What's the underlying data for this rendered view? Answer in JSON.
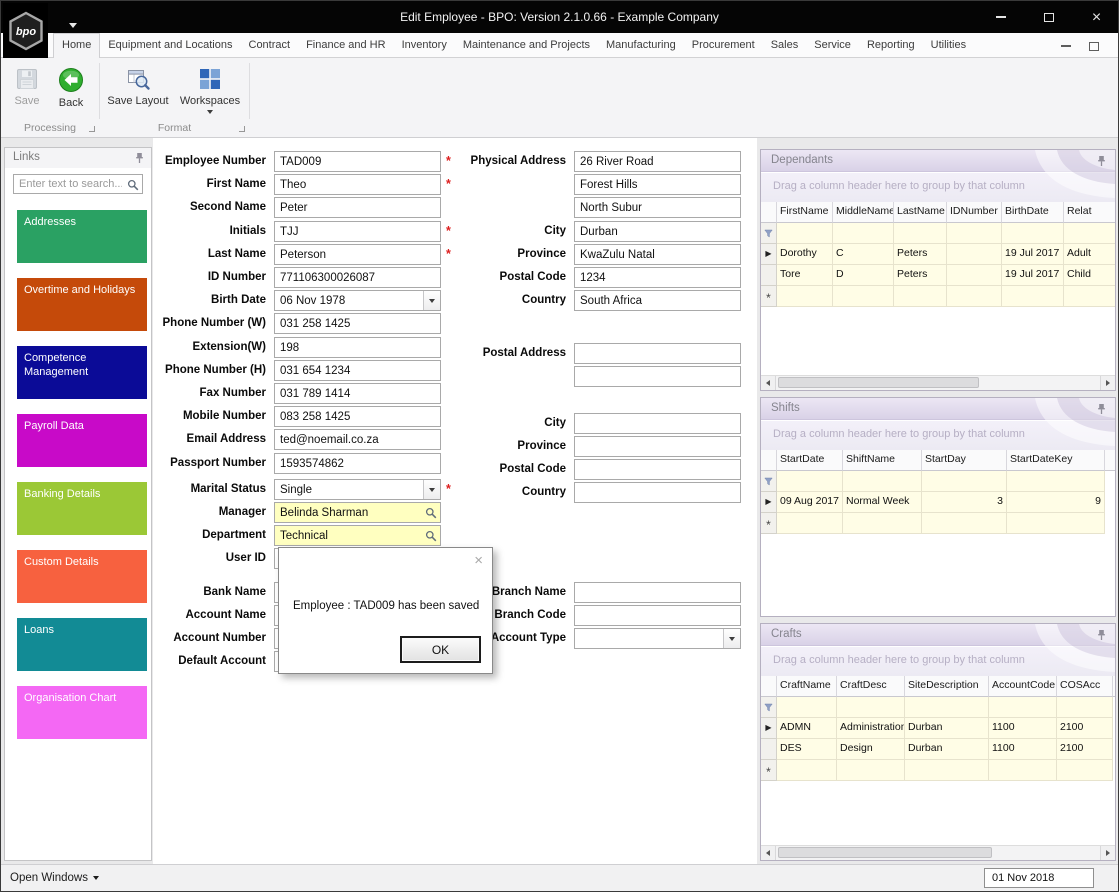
{
  "window": {
    "title": "Edit Employee - BPO: Version 2.1.0.66 - Example Company",
    "logo_text": "bpo"
  },
  "icons": {
    "close": "×",
    "row_arrow": "▶",
    "new_row": "*"
  },
  "ribbon": {
    "active_tab": 0,
    "tabs": [
      "Home",
      "Equipment and Locations",
      "Contract",
      "Finance and HR",
      "Inventory",
      "Maintenance and Projects",
      "Manufacturing",
      "Procurement",
      "Sales",
      "Service",
      "Reporting",
      "Utilities"
    ],
    "save_label": "Save",
    "back_label": "Back",
    "save_layout_label": "Save Layout",
    "workspaces_label": "Workspaces",
    "group_processing": "Processing",
    "group_format": "Format"
  },
  "links": {
    "header": "Links",
    "search_placeholder": "Enter text to search...",
    "items": [
      {
        "label": "Addresses",
        "color": "#2aa163"
      },
      {
        "label": "Overtime and Holidays",
        "color": "#c54a0a"
      },
      {
        "label": "Competence Management",
        "color": "#0b0b97"
      },
      {
        "label": "Payroll Data",
        "color": "#c80ac8"
      },
      {
        "label": "Banking Details",
        "color": "#9bc836"
      },
      {
        "label": "Custom Details",
        "color": "#f7613f"
      },
      {
        "label": "Loans",
        "color": "#128b95"
      },
      {
        "label": "Organisation Chart",
        "color": "#f468f4"
      }
    ]
  },
  "form": {
    "required_marker": "*",
    "left": [
      {
        "label": "Employee Number",
        "value": "TAD009",
        "type": "text",
        "required": true
      },
      {
        "label": "First Name",
        "value": "Theo",
        "type": "text",
        "required": true
      },
      {
        "label": "Second Name",
        "value": "Peter",
        "type": "text"
      },
      {
        "label": "Initials",
        "value": "TJJ",
        "type": "text",
        "required": true
      },
      {
        "label": "Last Name",
        "value": "Peterson",
        "type": "text",
        "required": true
      },
      {
        "label": "ID Number",
        "value": "771106300026087",
        "type": "text"
      },
      {
        "label": "Birth Date",
        "value": "06 Nov 1978",
        "type": "combo"
      },
      {
        "label": "Phone Number (W)",
        "value": "031 258 1425",
        "type": "text"
      },
      {
        "label": "Extension(W)",
        "value": "198",
        "type": "text"
      },
      {
        "label": "Phone Number (H)",
        "value": "031 654 1234",
        "type": "text"
      },
      {
        "label": "Fax Number",
        "value": "031 789 1414",
        "type": "text"
      },
      {
        "label": "Mobile Number",
        "value": "083 258 1425",
        "type": "text"
      },
      {
        "label": "Email Address",
        "value": "ted@noemail.co.za",
        "type": "text"
      },
      {
        "label": "Passport Number",
        "value": "1593574862",
        "type": "text"
      },
      {
        "label": "Marital Status",
        "value": "Single",
        "type": "combo",
        "required": true
      },
      {
        "label": "Manager",
        "value": "Belinda Sharman",
        "type": "lookup"
      },
      {
        "label": "Department",
        "value": "Technical",
        "type": "lookup"
      },
      {
        "label": "User ID",
        "value": "",
        "type": "text"
      },
      {
        "label": "Bank Name",
        "value": "",
        "type": "text"
      },
      {
        "label": "Account Name",
        "value": "",
        "type": "text"
      },
      {
        "label": "Account Number",
        "value": "",
        "type": "text"
      },
      {
        "label": "Default Account",
        "value": "",
        "type": "text"
      }
    ],
    "right": [
      {
        "label": "Physical Address",
        "value": "26 River Road",
        "type": "text"
      },
      {
        "label": "",
        "value": "Forest Hills",
        "type": "text"
      },
      {
        "label": "",
        "value": "North Subur",
        "type": "text"
      },
      {
        "label": "City",
        "value": "Durban",
        "type": "text"
      },
      {
        "label": "Province",
        "value": "KwaZulu Natal",
        "type": "text"
      },
      {
        "label": "Postal Code",
        "value": "1234",
        "type": "text"
      },
      {
        "label": "Country",
        "value": "South Africa",
        "type": "text"
      },
      {
        "label": "Postal Address",
        "value": "",
        "type": "text"
      },
      {
        "label": "",
        "value": "",
        "type": "text"
      },
      {
        "label": "City",
        "value": "",
        "type": "text"
      },
      {
        "label": "Province",
        "value": "",
        "type": "text"
      },
      {
        "label": "Postal Code",
        "value": "",
        "type": "text"
      },
      {
        "label": "Country",
        "value": "",
        "type": "text"
      },
      {
        "label": "Branch Name",
        "value": "",
        "type": "text"
      },
      {
        "label": "Branch Code",
        "value": "",
        "type": "text"
      },
      {
        "label": "Account Type",
        "value": "",
        "type": "combo"
      }
    ]
  },
  "dialog": {
    "message": "Employee : TAD009 has been saved",
    "ok_label": "OK"
  },
  "panels": {
    "drag_hint": "Drag a column header here to group by that column",
    "dependants": {
      "title": "Dependants",
      "columns": [
        "FirstName",
        "MiddleName",
        "LastName",
        "IDNumber",
        "BirthDate",
        "Relat"
      ],
      "rows": [
        [
          "Dorothy",
          "C",
          "Peters",
          "",
          "19 Jul 2017",
          "Adult"
        ],
        [
          "Tore",
          "D",
          "Peters",
          "",
          "19 Jul 2017",
          "Child"
        ]
      ]
    },
    "shifts": {
      "title": "Shifts",
      "columns": [
        "StartDate",
        "ShiftName",
        "StartDay",
        "StartDateKey"
      ],
      "rows": [
        [
          "09 Aug 2017",
          "Normal Week",
          "3",
          "9"
        ]
      ]
    },
    "crafts": {
      "title": "Crafts",
      "columns": [
        "CraftName",
        "CraftDesc",
        "SiteDescription",
        "AccountCode",
        "COSAcc"
      ],
      "rows": [
        [
          "ADMN",
          "Administration",
          "Durban",
          "1100",
          "2100"
        ],
        [
          "DES",
          "Design",
          "Durban",
          "1100",
          "2100"
        ]
      ]
    }
  },
  "statusbar": {
    "open_windows_label": "Open Windows",
    "date_value": "01 Nov 2018"
  }
}
